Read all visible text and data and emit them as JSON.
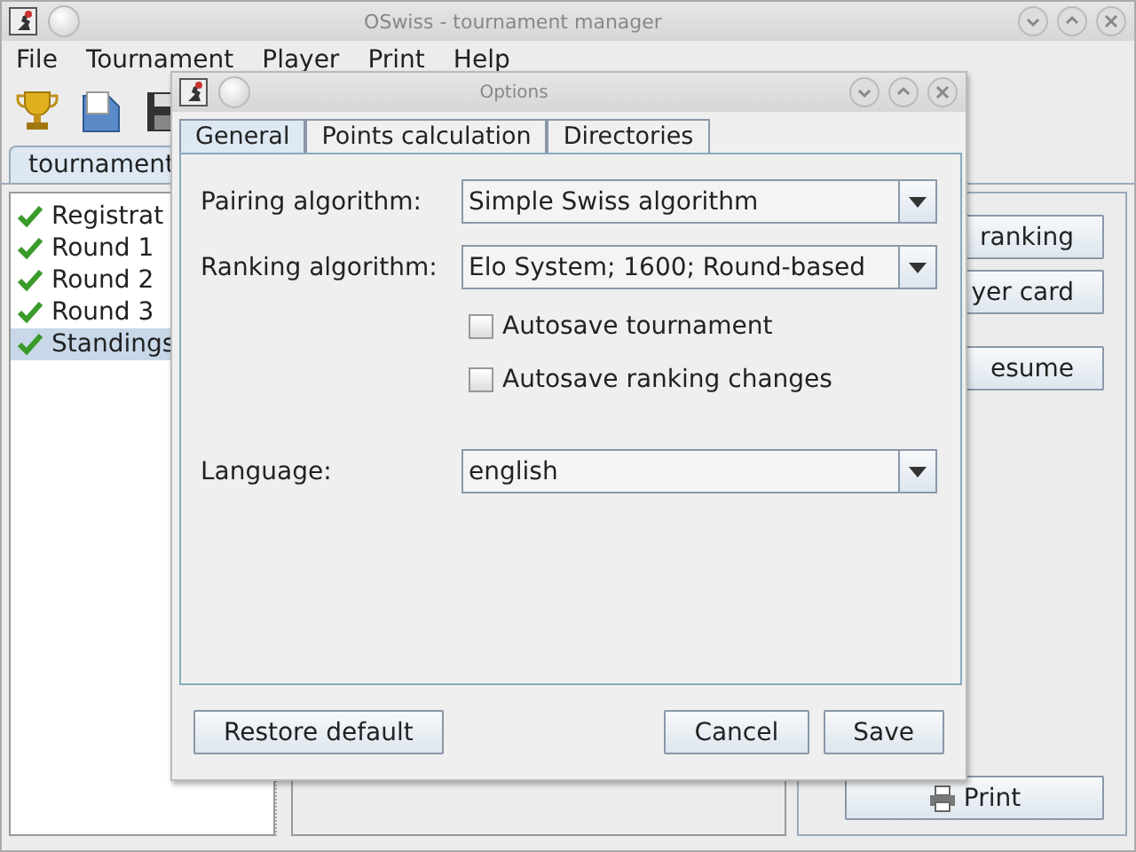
{
  "main_window": {
    "title": "OSwiss - tournament manager",
    "menu": [
      "File",
      "Tournament",
      "Player",
      "Print",
      "Help"
    ],
    "tab": {
      "label": "tournament"
    },
    "tree": [
      {
        "label": "Registrat",
        "checked": true,
        "selected": false
      },
      {
        "label": "Round 1",
        "checked": true,
        "selected": false
      },
      {
        "label": "Round 2",
        "checked": true,
        "selected": false
      },
      {
        "label": "Round 3",
        "checked": true,
        "selected": false
      },
      {
        "label": "Standings",
        "checked": true,
        "selected": true
      }
    ],
    "buttons": [
      "ranking",
      "yer card",
      "esume"
    ],
    "print_button": "Print"
  },
  "dialog": {
    "title": "Options",
    "tabs": [
      {
        "label": "General",
        "selected": true
      },
      {
        "label": "Points calculation",
        "selected": false
      },
      {
        "label": "Directories",
        "selected": false
      }
    ],
    "fields": [
      {
        "kind": "combo",
        "label": "Pairing algorithm:",
        "value": "Simple Swiss algorithm"
      },
      {
        "kind": "combo",
        "label": "Ranking algorithm:",
        "value": "Elo System; 1600; Round-based"
      },
      {
        "kind": "checkbox",
        "label": "Autosave tournament",
        "checked": false
      },
      {
        "kind": "checkbox",
        "label": "Autosave ranking changes",
        "checked": false
      },
      {
        "kind": "combo",
        "label": "Language:",
        "value": "english"
      }
    ],
    "buttons_left": [
      "Restore default"
    ],
    "buttons_right": [
      "Cancel",
      "Save"
    ]
  }
}
